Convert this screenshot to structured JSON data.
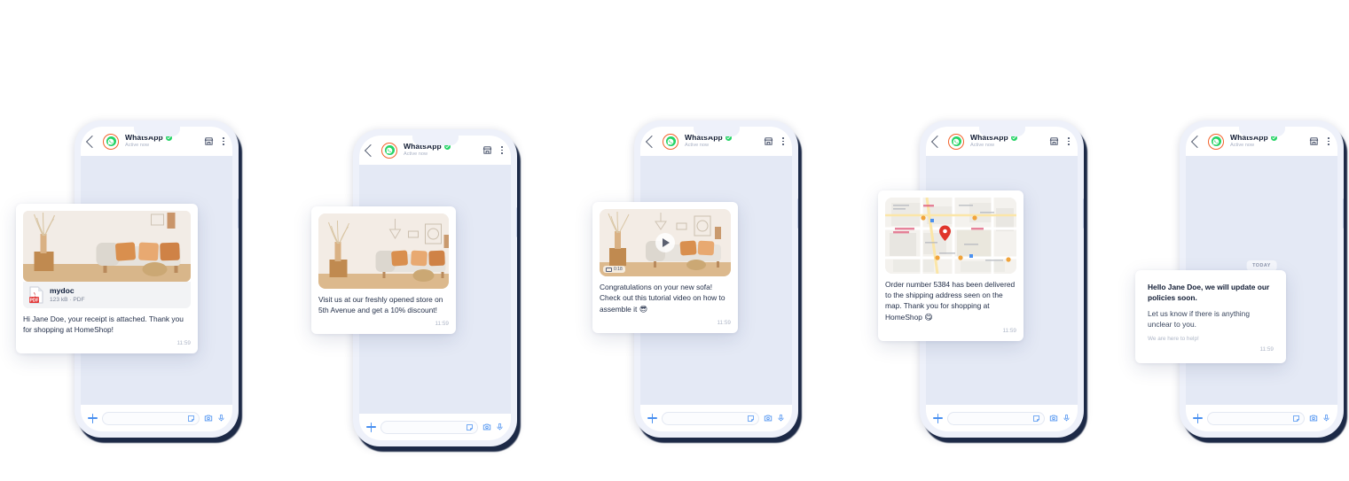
{
  "page": {
    "background": "#ffffff",
    "phone_body_color": "#eef1fa",
    "chat_background": "#e4e9f5",
    "accent_whatsapp_green": "#25d366",
    "accent_orange_ring": "#f2622a",
    "accent_blue": "#4a90f0",
    "text_dark": "#101b33"
  },
  "header": {
    "back_icon": "chevron-left-icon",
    "avatar_icon": "whatsapp-avatar-icon",
    "title": "WhatsApp",
    "verified_icon": "verified-badge-icon",
    "subtitle": "Active now",
    "store_icon": "storefront-icon",
    "menu_icon": "three-dot-menu-icon"
  },
  "input_bar": {
    "plus_icon": "plus-icon",
    "field_placeholder": "",
    "field_value": "",
    "sticker_icon": "sticker-icon",
    "camera_icon": "camera-icon",
    "mic_icon": "microphone-icon"
  },
  "phones": [
    {
      "id": "phone-document",
      "message": {
        "kind": "document",
        "media_icon": "living-room-photo",
        "doc_icon": "pdf-file-icon",
        "doc_name": "mydoc",
        "doc_meta": "123 kB · PDF",
        "text": "Hi Jane Doe, your receipt is attached. Thank you for shopping at HomeShop!",
        "timestamp": "11:59"
      }
    },
    {
      "id": "phone-image",
      "message": {
        "kind": "image",
        "media_icon": "living-room-photo",
        "text": "Visit us at our freshly opened store on 5th Avenue and get a 10% discount!",
        "timestamp": "11:59"
      }
    },
    {
      "id": "phone-video",
      "message": {
        "kind": "video",
        "media_icon": "living-room-video-thumbnail",
        "play_icon": "play-button-icon",
        "video_badge_icon": "video-camera-icon",
        "video_duration": "0:18",
        "text": "Congratulations on your new sofa! Check out this tutorial video on how to assemble it ",
        "emoji": "😎",
        "timestamp": "11:59"
      }
    },
    {
      "id": "phone-location",
      "message": {
        "kind": "location",
        "media_icon": "map-thumbnail",
        "pin_icon": "map-pin-icon",
        "text": "Order number 5384 has been delivered to the shipping address seen on the map. Thank you for shopping at HomeShop ",
        "emoji": "😋",
        "timestamp": "11:59"
      }
    },
    {
      "id": "phone-text",
      "day_divider": "TODAY",
      "message": {
        "kind": "text",
        "heading": "Hello Jane Doe, we will update our policies soon.",
        "body": "Let us know if there is anything unclear to you.",
        "footer": "We are here to help!",
        "timestamp": "11:59"
      }
    }
  ]
}
